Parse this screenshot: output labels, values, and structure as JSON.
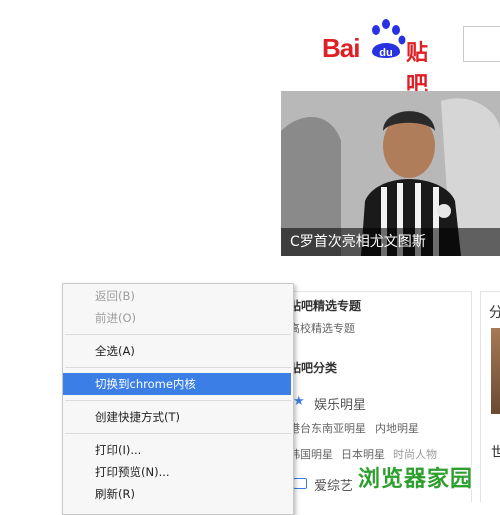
{
  "header": {
    "logo_text_bai": "Bai",
    "logo_text_du": "du",
    "logo_text_tieba": "贴吧"
  },
  "hero": {
    "caption": "C罗首次亮相尤文图斯"
  },
  "panel": {
    "featured_title": "贴吧精选专题",
    "featured_link": "高校精选专题",
    "category_title": "贴吧分类",
    "entertainment_label": "娱乐明星",
    "ent_links": [
      "港台东南亚明星",
      "内地明星"
    ],
    "ent_links_2": [
      "韩国明星",
      "日本明星",
      "时尚人物"
    ],
    "variety_label": "爱综艺"
  },
  "right_panel": {
    "top_char": "分",
    "bottom_char": "世"
  },
  "context_menu": {
    "items": [
      {
        "label": "返回(B)",
        "disabled": true
      },
      {
        "label": "前进(O)",
        "disabled": true
      },
      {
        "label": "全选(A)",
        "disabled": false
      },
      {
        "label": "切换到chrome内核",
        "disabled": false,
        "highlight": true
      },
      {
        "label": "创建快捷方式(T)",
        "disabled": false
      },
      {
        "label": "打印(I)...",
        "disabled": false
      },
      {
        "label": "打印预览(N)...",
        "disabled": false
      },
      {
        "label": "刷新(R)",
        "disabled": false
      }
    ]
  },
  "watermark": "浏览器家园",
  "colors": {
    "brand_red": "#de1f26",
    "brand_blue": "#2932e1",
    "menu_highlight": "#3a7ee6",
    "watermark_green": "#2d9f2d"
  }
}
